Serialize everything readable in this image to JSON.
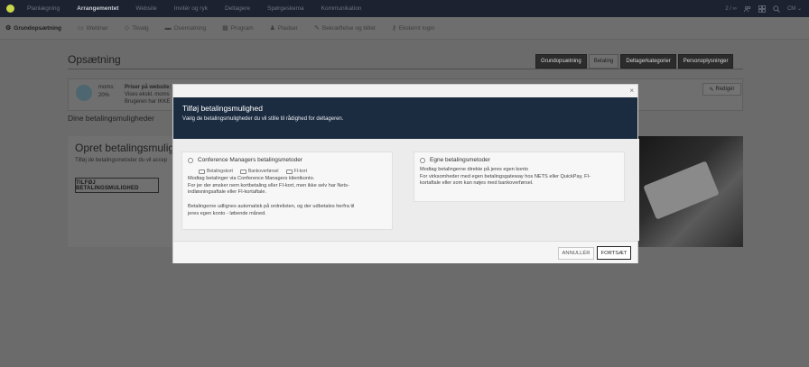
{
  "topnav": {
    "items": [
      "Planlægning",
      "Arrangementet",
      "Website",
      "Invitér og ryk",
      "Deltagere",
      "Spørgeskema",
      "Kommunikation"
    ],
    "active_index": 1,
    "counter": "2 / ∞",
    "user_initials": "CM"
  },
  "subnav": {
    "items": [
      {
        "label": "Grundopsætning",
        "icon": "gear-icon",
        "glyph": "⚙"
      },
      {
        "label": "Webinar",
        "icon": "monitor-icon",
        "glyph": "▭"
      },
      {
        "label": "Tilvalg",
        "icon": "tag-icon",
        "glyph": "◇"
      },
      {
        "label": "Overnatning",
        "icon": "bed-icon",
        "glyph": "▬"
      },
      {
        "label": "Program",
        "icon": "calendar-icon",
        "glyph": "▦"
      },
      {
        "label": "Pladser",
        "icon": "seat-icon",
        "glyph": "♟"
      },
      {
        "label": "Bekræftelse og billet",
        "icon": "pen-icon",
        "glyph": "✎"
      },
      {
        "label": "Eksternt login",
        "icon": "key-icon",
        "glyph": "⚷"
      }
    ]
  },
  "page": {
    "title": "Opsætning",
    "tabs": [
      "Grundopsætning",
      "Betaling",
      "Deltagerkategorier",
      "Personoplysninger"
    ],
    "active_tab": 1,
    "info": {
      "moms_label": "moms:",
      "moms_value": "20%",
      "prices_title": "Priser på website:",
      "prices_line1": "Vises ekskl. moms",
      "prices_line2": "Brugeren har IKKE"
    },
    "edit_label": "Redigér",
    "section_label": "Dine betalingsmuligheder",
    "create_title": "Opret betalingsmulighe",
    "create_sub": "Tilføj de betalingsmetoder du vil accep",
    "add_button": "TILFØJ BETALINGSMULIGHED"
  },
  "modal": {
    "close": "×",
    "title": "Tilføj betalingsmulighed",
    "subtitle": "Vælg de betalingsmuligheder du vil stille til rådighed for deltageren.",
    "option1": {
      "label": "Conference Managers betalingsmetoder",
      "methods": [
        "Betalingskort",
        "Bankoverførsel",
        "FI-kort"
      ],
      "text_lines": [
        "Modtag betalinger via Conference Managers klientkonto.",
        "For jer der ønsker nem kortbetaling eller FI-kort, men ikke selv har Nets-",
        "indløsningsaftale eller FI-kortaftale."
      ],
      "text2_lines": [
        "Betalingerne udlignes automatisk på ordrelisten, og der udbetales herfra til",
        "jeres egen konto - løbende måned."
      ]
    },
    "option2": {
      "label": "Egne betalingsmetoder",
      "text_lines": [
        "Modtag betalingerne direkte på jeres egen konto",
        "For virksomheder med egen betalingsgateway hos NETS eller QuickPay, FI-",
        "kortaftale eller som kan nøjes med bankoverførsel."
      ]
    },
    "cancel": "ANNULLÉR",
    "continue": "FORTSÆT"
  }
}
